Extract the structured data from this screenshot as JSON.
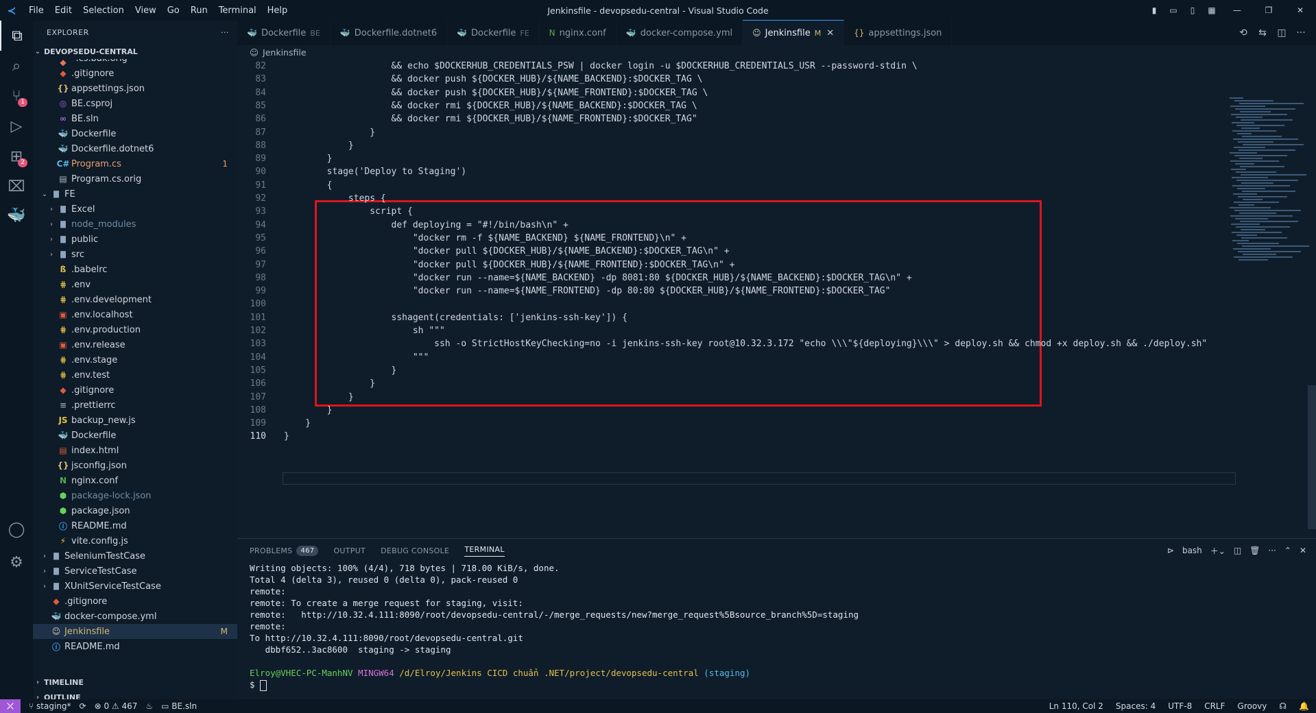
{
  "window": {
    "title": "Jenkinsfile - devopsedu-central - Visual Studio Code",
    "menu": [
      "File",
      "Edit",
      "Selection",
      "View",
      "Go",
      "Run",
      "Terminal",
      "Help"
    ]
  },
  "activity_bar": {
    "scm_badge": "1",
    "extensions_badge": "2"
  },
  "explorer": {
    "header": "EXPLORER",
    "root": "DEVOPSEDU-CENTRAL",
    "items": [
      {
        "name": "*.cs.bak.orig",
        "indent": 2,
        "type": "file",
        "icon": "config-icon",
        "cls": "partial"
      },
      {
        "name": ".gitignore",
        "indent": 2,
        "type": "file",
        "icon": "git-icon"
      },
      {
        "name": "appsettings.json",
        "indent": 2,
        "type": "file",
        "icon": "json-icon"
      },
      {
        "name": "BE.csproj",
        "indent": 2,
        "type": "file",
        "icon": "rss-icon"
      },
      {
        "name": "BE.sln",
        "indent": 2,
        "type": "file",
        "icon": "vs-icon"
      },
      {
        "name": "Dockerfile",
        "indent": 2,
        "type": "file",
        "icon": "docker-icon"
      },
      {
        "name": "Dockerfile.dotnet6",
        "indent": 2,
        "type": "file",
        "icon": "docker-icon"
      },
      {
        "name": "Program.cs",
        "indent": 2,
        "type": "file",
        "icon": "csharp-icon",
        "cls": "err",
        "mark": "1"
      },
      {
        "name": "Program.cs.orig",
        "indent": 2,
        "type": "file",
        "icon": "file-icon"
      },
      {
        "name": "FE",
        "indent": 1,
        "type": "folder-open"
      },
      {
        "name": "Excel",
        "indent": 2,
        "type": "folder"
      },
      {
        "name": "node_modules",
        "indent": 2,
        "type": "folder",
        "cls": "dim"
      },
      {
        "name": "public",
        "indent": 2,
        "type": "folder"
      },
      {
        "name": "src",
        "indent": 2,
        "type": "folder"
      },
      {
        "name": ".babelrc",
        "indent": 2,
        "type": "file",
        "icon": "babel-icon"
      },
      {
        "name": ".env",
        "indent": 2,
        "type": "file",
        "icon": "env-icon"
      },
      {
        "name": ".env.development",
        "indent": 2,
        "type": "file",
        "icon": "env-icon"
      },
      {
        "name": ".env.localhost",
        "indent": 2,
        "type": "file",
        "icon": "terminal-icon"
      },
      {
        "name": ".env.production",
        "indent": 2,
        "type": "file",
        "icon": "env-icon"
      },
      {
        "name": ".env.release",
        "indent": 2,
        "type": "file",
        "icon": "terminal-icon"
      },
      {
        "name": ".env.stage",
        "indent": 2,
        "type": "file",
        "icon": "env-icon"
      },
      {
        "name": ".env.test",
        "indent": 2,
        "type": "file",
        "icon": "env-icon"
      },
      {
        "name": ".gitignore",
        "indent": 2,
        "type": "file",
        "icon": "git-icon"
      },
      {
        "name": ".prettierrc",
        "indent": 2,
        "type": "file",
        "icon": "prettier-icon"
      },
      {
        "name": "backup_new.js",
        "indent": 2,
        "type": "file",
        "icon": "js-icon"
      },
      {
        "name": "Dockerfile",
        "indent": 2,
        "type": "file",
        "icon": "docker-icon"
      },
      {
        "name": "index.html",
        "indent": 2,
        "type": "file",
        "icon": "html-icon"
      },
      {
        "name": "jsconfig.json",
        "indent": 2,
        "type": "file",
        "icon": "jsconfig-icon"
      },
      {
        "name": "nginx.conf",
        "indent": 2,
        "type": "file",
        "icon": "nginx-icon"
      },
      {
        "name": "package-lock.json",
        "indent": 2,
        "type": "file",
        "icon": "npm-icon",
        "cls": "dim"
      },
      {
        "name": "package.json",
        "indent": 2,
        "type": "file",
        "icon": "npm-icon"
      },
      {
        "name": "README.md",
        "indent": 2,
        "type": "file",
        "icon": "info-icon"
      },
      {
        "name": "vite.config.js",
        "indent": 2,
        "type": "file",
        "icon": "vite-icon"
      },
      {
        "name": "SeleniumTestCase",
        "indent": 1,
        "type": "folder"
      },
      {
        "name": "ServiceTestCase",
        "indent": 1,
        "type": "folder"
      },
      {
        "name": "XUnitServiceTestCase",
        "indent": 1,
        "type": "folder"
      },
      {
        "name": ".gitignore",
        "indent": 1,
        "type": "file",
        "icon": "git-icon"
      },
      {
        "name": "docker-compose.yml",
        "indent": 1,
        "type": "file",
        "icon": "docker-icon"
      },
      {
        "name": "Jenkinsfile",
        "indent": 1,
        "type": "file",
        "icon": "jenkins-icon",
        "cls": "mod",
        "mark": "M",
        "selected": true
      },
      {
        "name": "README.md",
        "indent": 1,
        "type": "file",
        "icon": "info-icon"
      }
    ],
    "timeline": "TIMELINE",
    "outline": "OUTLINE"
  },
  "tabs": [
    {
      "label": "Dockerfile",
      "suffix": "BE",
      "icon": "docker-icon"
    },
    {
      "label": "Dockerfile.dotnet6",
      "suffix": "",
      "icon": "docker-icon"
    },
    {
      "label": "Dockerfile",
      "suffix": "FE",
      "icon": "docker-icon"
    },
    {
      "label": "nginx.conf",
      "suffix": "",
      "icon": "nginx-icon"
    },
    {
      "label": "docker-compose.yml",
      "suffix": "",
      "icon": "docker-icon"
    },
    {
      "label": "Jenkinsfile",
      "suffix": "M",
      "icon": "jenkins-icon",
      "active": true
    },
    {
      "label": "appsettings.json",
      "suffix": "",
      "icon": "json-icon"
    }
  ],
  "breadcrumb": "Jenkinsfile",
  "code": {
    "current_line": 110,
    "lines": [
      {
        "n": 82,
        "t": "                    && echo $DOCKERHUB_CREDENTIALS_PSW | docker login -u $DOCKERHUB_CREDENTIALS_USR --password-stdin \\"
      },
      {
        "n": 83,
        "t": "                    && docker push ${DOCKER_HUB}/${NAME_BACKEND}:$DOCKER_TAG \\"
      },
      {
        "n": 84,
        "t": "                    && docker push ${DOCKER_HUB}/${NAME_FRONTEND}:$DOCKER_TAG \\"
      },
      {
        "n": 85,
        "t": "                    && docker rmi ${DOCKER_HUB}/${NAME_BACKEND}:$DOCKER_TAG \\"
      },
      {
        "n": 86,
        "t": "                    && docker rmi ${DOCKER_HUB}/${NAME_FRONTEND}:$DOCKER_TAG\""
      },
      {
        "n": 87,
        "t": "                }"
      },
      {
        "n": 88,
        "t": "            }"
      },
      {
        "n": 89,
        "t": "        }"
      },
      {
        "n": 90,
        "t": "        stage('Deploy to Staging')"
      },
      {
        "n": 91,
        "t": "        {"
      },
      {
        "n": 92,
        "t": "            steps {"
      },
      {
        "n": 93,
        "t": "                script {"
      },
      {
        "n": 94,
        "t": "                    def deploying = \"#!/bin/bash\\n\" +"
      },
      {
        "n": 95,
        "t": "                        \"docker rm -f ${NAME_BACKEND} ${NAME_FRONTEND}\\n\" +"
      },
      {
        "n": 96,
        "t": "                        \"docker pull ${DOCKER_HUB}/${NAME_BACKEND}:$DOCKER_TAG\\n\" +"
      },
      {
        "n": 97,
        "t": "                        \"docker pull ${DOCKER_HUB}/${NAME_FRONTEND}:$DOCKER_TAG\\n\" +"
      },
      {
        "n": 98,
        "t": "                        \"docker run --name=${NAME_BACKEND} -dp 8081:80 ${DOCKER_HUB}/${NAME_BACKEND}:$DOCKER_TAG\\n\" +"
      },
      {
        "n": 99,
        "t": "                        \"docker run --name=${NAME_FRONTEND} -dp 80:80 ${DOCKER_HUB}/${NAME_FRONTEND}:$DOCKER_TAG\""
      },
      {
        "n": 100,
        "t": ""
      },
      {
        "n": 101,
        "t": "                    sshagent(credentials: ['jenkins-ssh-key']) {"
      },
      {
        "n": 102,
        "t": "                        sh \"\"\""
      },
      {
        "n": 103,
        "t": "                            ssh -o StrictHostKeyChecking=no -i jenkins-ssh-key root@10.32.3.172 \"echo \\\\\\\"${deploying}\\\\\\\" > deploy.sh && chmod +x deploy.sh && ./deploy.sh\""
      },
      {
        "n": 104,
        "t": "                        \"\"\""
      },
      {
        "n": 105,
        "t": "                    }"
      },
      {
        "n": 106,
        "t": "                }"
      },
      {
        "n": 107,
        "t": "            }"
      },
      {
        "n": 108,
        "t": "        }"
      },
      {
        "n": 109,
        "t": "    }"
      },
      {
        "n": 110,
        "t": "}"
      }
    ]
  },
  "panel": {
    "tabs": [
      {
        "label": "PROBLEMS",
        "badge": "467"
      },
      {
        "label": "OUTPUT"
      },
      {
        "label": "DEBUG CONSOLE"
      },
      {
        "label": "TERMINAL",
        "active": true
      }
    ],
    "shell": "bash",
    "terminal_lines": [
      "Writing objects: 100% (4/4), 718 bytes | 718.00 KiB/s, done.",
      "Total 4 (delta 3), reused 0 (delta 0), pack-reused 0",
      "remote:",
      "remote: To create a merge request for staging, visit:",
      "remote:   http://10.32.4.111:8090/root/devopsedu-central/-/merge_requests/new?merge_request%5Bsource_branch%5D=staging",
      "remote:",
      "To http://10.32.4.111:8090/root/devopsedu-central.git",
      "   dbbf652..3ac8600  staging -> staging",
      ""
    ],
    "prompt": {
      "user": "Elroy@VHEC-PC-ManhNV",
      "env": "MINGW64",
      "path": "/d/Elroy/Jenkins CICD chuẩn .NET/project/devopsedu-central",
      "branch": "(staging)",
      "symbol": "$"
    }
  },
  "status": {
    "branch": "staging*",
    "errors": "0",
    "warnings": "467",
    "solution": "BE.sln",
    "position": "Ln 110, Col 2",
    "spaces": "Spaces: 4",
    "encoding": "UTF-8",
    "eol": "CRLF",
    "language": "Groovy"
  },
  "colors": {
    "accent": "#3b9cf0",
    "highlight_box": "#e0141b",
    "status_remote": "#9e57d6"
  }
}
